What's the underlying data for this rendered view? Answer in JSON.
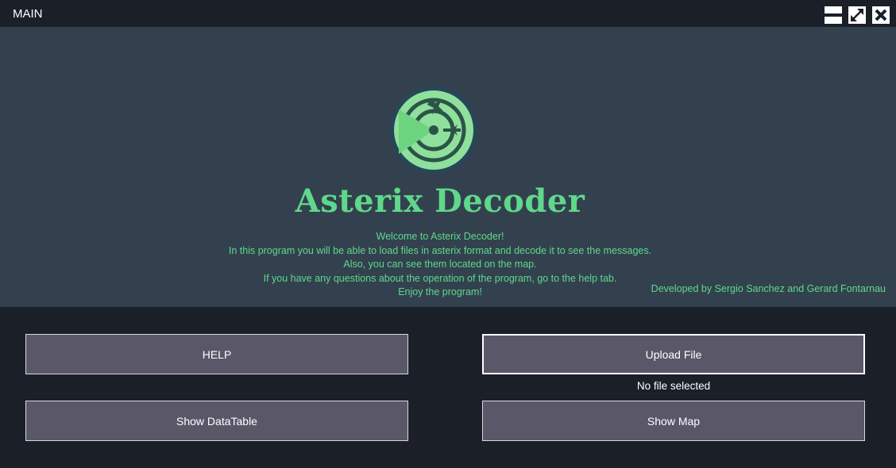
{
  "window": {
    "title": "MAIN",
    "controls": {
      "minimize_icon": "minimize-icon",
      "maximize_icon": "maximize-icon",
      "close_icon": "close-icon"
    }
  },
  "hero": {
    "logo_icon": "radar-plane-icon",
    "app_name": "Asterix Decoder",
    "welcome_lines": [
      "Welcome to Asterix Decoder!",
      "In this program you will be able to load files in asterix format and decode it to see the messages.",
      "Also, you can see them located on the map.",
      "If you have any questions about the operation of the program, go to the help tab.",
      "Enjoy the program!"
    ],
    "credits": "Developed by Sergio Sanchez and Gerard Fontarnau"
  },
  "actions": {
    "help_label": "HELP",
    "upload_label": "Upload File",
    "file_status": "No file selected",
    "datatable_label": "Show DataTable",
    "map_label": "Show Map"
  },
  "colors": {
    "accent_green": "#5fd88a",
    "hero_background": "#33414f",
    "window_background": "#1a1f28",
    "button_background": "#5a5768"
  }
}
